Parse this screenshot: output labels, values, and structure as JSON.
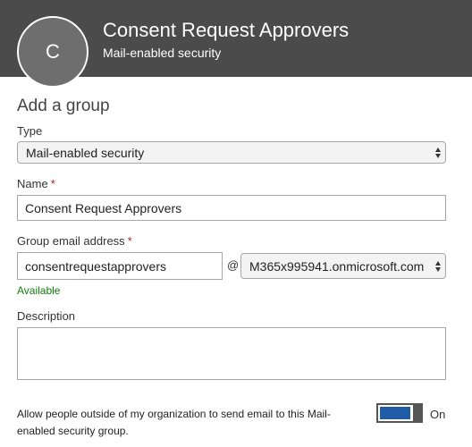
{
  "header": {
    "avatar_initial": "C",
    "title": "Consent Request Approvers",
    "subtitle": "Mail-enabled security"
  },
  "form": {
    "section_title": "Add a group",
    "type": {
      "label": "Type",
      "value": "Mail-enabled security"
    },
    "name": {
      "label": "Name",
      "required_marker": "*",
      "value": "Consent Request Approvers"
    },
    "email": {
      "label": "Group email address",
      "required_marker": "*",
      "value": "consentrequestapprovers",
      "at": "@",
      "domain": "M365x995941.onmicrosoft.com",
      "availability": "Available"
    },
    "description": {
      "label": "Description",
      "value": ""
    },
    "external_email": {
      "text": "Allow people outside of my organization to send email to this Mail-enabled security group.",
      "state_label": "On",
      "checked": true
    }
  },
  "colors": {
    "header_bg": "#4b4b4b",
    "avatar_bg": "#6e6e6e",
    "required": "#a4262c",
    "available": "#107c10",
    "toggle_on": "#1f5ba6"
  },
  "icons": [
    "select-arrows-icon"
  ]
}
